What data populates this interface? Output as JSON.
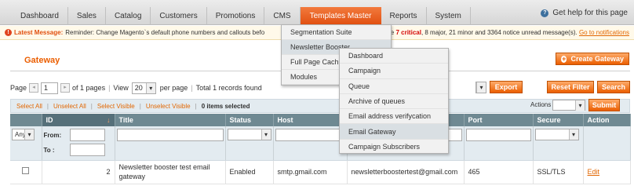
{
  "nav": {
    "items": [
      "Dashboard",
      "Sales",
      "Catalog",
      "Customers",
      "Promotions",
      "CMS",
      "Templates Master",
      "Reports",
      "System"
    ],
    "active": "Templates Master",
    "help": "Get help for this page"
  },
  "message": {
    "label": "Latest Message:",
    "text": "Reminder: Change Magento`s default phone numbers and callouts befo",
    "tail_prefix": "e ",
    "critical": "7 critical",
    "counts": ", 8 major, 21 minor and 3364 notice unread message(s).",
    "link": "Go to notifications"
  },
  "page": {
    "title": "Gateway",
    "create_button": "Create Gateway",
    "export_button": "Export",
    "reset_button": "Reset Filter",
    "search_button": "Search",
    "submit_button": "Submit",
    "actions_label": "Actions"
  },
  "pager": {
    "page_label": "Page",
    "page_value": "1",
    "of_pages": "of 1 pages",
    "view_label": "View",
    "view_value": "20",
    "per_page": "per page",
    "total": "Total 1 records found"
  },
  "mass": {
    "select_all": "Select All",
    "unselect_all": "Unselect All",
    "select_visible": "Select Visible",
    "unselect_visible": "Unselect Visible",
    "selected": "0 items selected"
  },
  "grid": {
    "columns": [
      "",
      "ID",
      "Title",
      "Status",
      "Host",
      "",
      "Port",
      "Secure",
      "Action"
    ],
    "filter": {
      "any": "Any",
      "from": "From:",
      "to": "To :"
    },
    "row": {
      "id": "2",
      "title": "Newsletter booster test email gateway",
      "status": "Enabled",
      "host": "smtp.gmail.com",
      "user": "newsletterboostertest@gmail.com",
      "port": "465",
      "secure": "SSL/TLS",
      "action": "Edit"
    }
  },
  "menu": {
    "items": [
      "Segmentation Suite",
      "Newsletter Booster",
      "Full Page Cach",
      "Modules"
    ],
    "hovered": "Newsletter Booster"
  },
  "submenu": {
    "items": [
      "Dashboard",
      "Campaign",
      "Queue",
      "Archive of queues",
      "Email address verifycation",
      "Email Gateway",
      "Campaign Subscribers"
    ],
    "hovered": "Email Gateway"
  }
}
